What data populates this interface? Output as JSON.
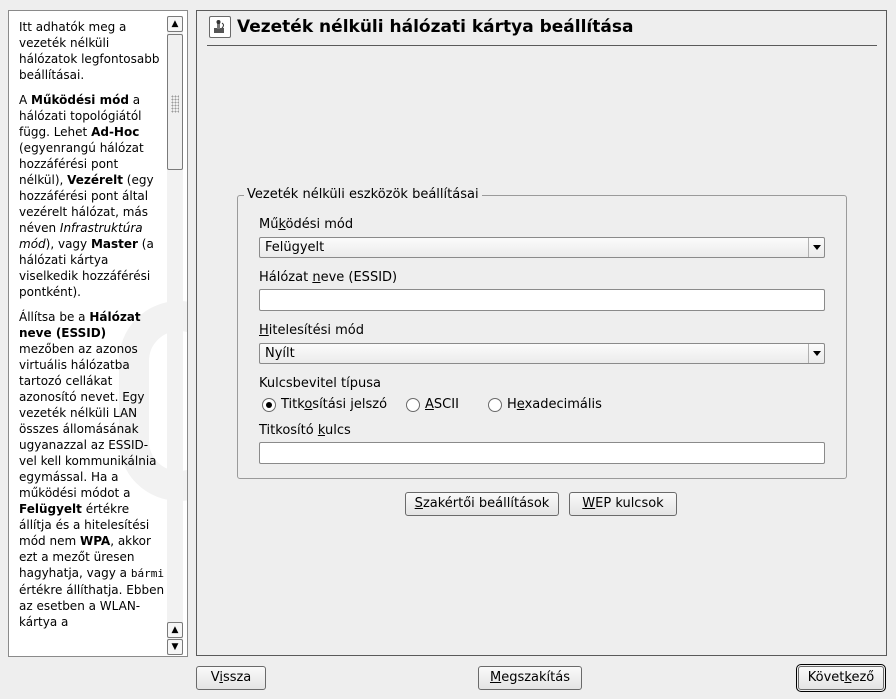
{
  "help": {
    "paragraphs": [
      [
        {
          "t": "Itt adhatók meg a vezeték nélküli hálózatok legfontosabb beállításai."
        }
      ],
      [
        {
          "t": "A "
        },
        {
          "t": "Működési mód",
          "b": true
        },
        {
          "t": " a hálózati topológiától függ. Lehet "
        },
        {
          "t": "Ad-Hoc",
          "b": true
        },
        {
          "t": " (egyenrangú hálózat hozzáférési pont nélkül), "
        },
        {
          "t": "Vezérelt",
          "b": true
        },
        {
          "t": " (egy hozzáférési pont által vezérelt hálózat, más néven "
        },
        {
          "t": "Infrastruktúra mód",
          "i": true
        },
        {
          "t": "), vagy "
        },
        {
          "t": "Master",
          "b": true
        },
        {
          "t": " (a hálózati kártya viselkedik hozzáférési pontként)."
        }
      ],
      [
        {
          "t": "Állítsa be a "
        },
        {
          "t": "Hálózat neve (ESSID)",
          "b": true
        },
        {
          "t": " mezőben az azonos virtuális hálózatba tartozó cellákat azonosító nevet. Egy vezeték nélküli LAN összes állomásának ugyanazzal az ESSID-vel kell kommunikálnia egymással. Ha a működési módot a "
        },
        {
          "t": "Felügyelt",
          "b": true
        },
        {
          "t": " értékre állítja és a hitelesítési mód nem "
        },
        {
          "t": "WPA",
          "b": true
        },
        {
          "t": ", akkor ezt a mezőt üresen hagyhatja, vagy a "
        },
        {
          "t": "bármi",
          "m": true
        },
        {
          "t": " értékre állíthatja. Ebben az esetben a WLAN-kártya a"
        }
      ]
    ],
    "scroll_up_icon": "arrow-up-icon",
    "scroll_down_icon": "arrow-down-icon"
  },
  "header": {
    "title": "Vezeték nélküli hálózati kártya beállítása",
    "icon": "network-card-icon"
  },
  "frame": {
    "legend": "Vezeték nélküli eszközök beállításai",
    "mode_label_pre": "Mű",
    "mode_label_u": "k",
    "mode_label_post": "ödési mód",
    "mode_value": "Felügyelt",
    "essid_label_pre": "Hálózat ",
    "essid_label_u": "n",
    "essid_label_post": "eve (ESSID)",
    "essid_value": "",
    "auth_label_pre": "",
    "auth_label_u": "H",
    "auth_label_post": "itelesítési mód",
    "auth_value": "Nyílt",
    "keytype_label": "Kulcsbevitel típusa",
    "radio_passphrase_pre": "Titk",
    "radio_passphrase_u": "o",
    "radio_passphrase_post": "sítási jelszó",
    "radio_ascii_pre": "",
    "radio_ascii_u": "A",
    "radio_ascii_post": "SCII",
    "radio_hex_pre": "H",
    "radio_hex_u": "e",
    "radio_hex_post": "xadecimális",
    "selected_key_type": "passphrase",
    "key_label_pre": "Titkosító ",
    "key_label_u": "k",
    "key_label_post": "ulcs",
    "key_value": ""
  },
  "buttons": {
    "expert_pre": "",
    "expert_u": "S",
    "expert_post": "zakértői beállítások",
    "wep_pre": "",
    "wep_u": "W",
    "wep_post": "EP kulcsok",
    "back_pre": "V",
    "back_u": "i",
    "back_post": "ssza",
    "abort_pre": "",
    "abort_u": "M",
    "abort_post": "egszakítás",
    "next_pre": "Követ",
    "next_u": "k",
    "next_post": "ező"
  }
}
